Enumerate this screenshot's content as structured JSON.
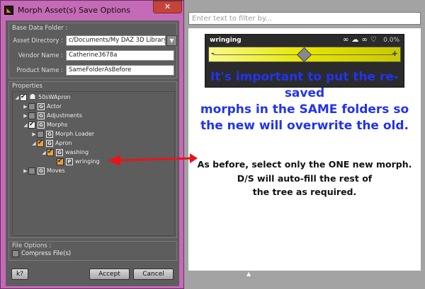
{
  "dialog": {
    "title": "Morph Asset(s) Save Options",
    "close_label": "✕",
    "app_icon_glyph": "◣",
    "base_data_folder": {
      "title": "Base Data Folder :",
      "asset_directory_label": "Asset Directory :",
      "asset_directory_value": "c/Documents/My DAZ 3D Library",
      "vendor_name_label": "Vendor Name :",
      "vendor_name_value": "Catherine3678a",
      "product_name_label": "Product Name :",
      "product_name_value": "SameFolderAsBefore"
    },
    "properties": {
      "title": "Properties",
      "tree": [
        {
          "label": "50sWApron",
          "state": "checked",
          "icon": "people-icon"
        },
        {
          "label": "Actor",
          "state": "unchecked",
          "icon": "G"
        },
        {
          "label": "Adjustments",
          "state": "unchecked",
          "icon": "G"
        },
        {
          "label": "Morphs",
          "state": "checked",
          "icon": "G"
        },
        {
          "label": "Morph Loader",
          "state": "unchecked",
          "icon": "G"
        },
        {
          "label": "Apron",
          "state": "partial",
          "icon": "G"
        },
        {
          "label": "washing",
          "state": "partial",
          "icon": "G"
        },
        {
          "label": "wringing",
          "state": "partial",
          "icon": "P"
        },
        {
          "label": "Moves",
          "state": "unchecked",
          "icon": "G"
        }
      ]
    },
    "file_options": {
      "title": "File Options :",
      "compress_label": "Compress File(s)"
    },
    "buttons": {
      "help_label": "k?",
      "accept_label": "Accept",
      "cancel_label": "Cancel"
    }
  },
  "right_pane": {
    "filter_placeholder": "Enter text to filter by...",
    "slider": {
      "name": "wringing",
      "value": "0.0%",
      "minus": "-",
      "plus": "+",
      "level_fraction": 0.5,
      "icons": [
        "link-icon",
        "cloud-icon",
        "link-icon",
        "heart-icon"
      ]
    },
    "annotation_main": [
      "It's important to put the re-saved",
      "morphs in the SAME folders so",
      "the new will overwrite the old."
    ],
    "annotation_secondary": [
      "As before, select only the ONE new morph.",
      "D/S will auto-fill the rest of",
      "the tree as required."
    ],
    "toggle_glyph": "▲"
  },
  "colors": {
    "dialog_frame": "#c56ab6",
    "dialog_body": "#5d5d5d",
    "annotation_blue": "#2233ee",
    "arrow_red": "#e8141c",
    "slider_yellow": "#e6e600"
  }
}
